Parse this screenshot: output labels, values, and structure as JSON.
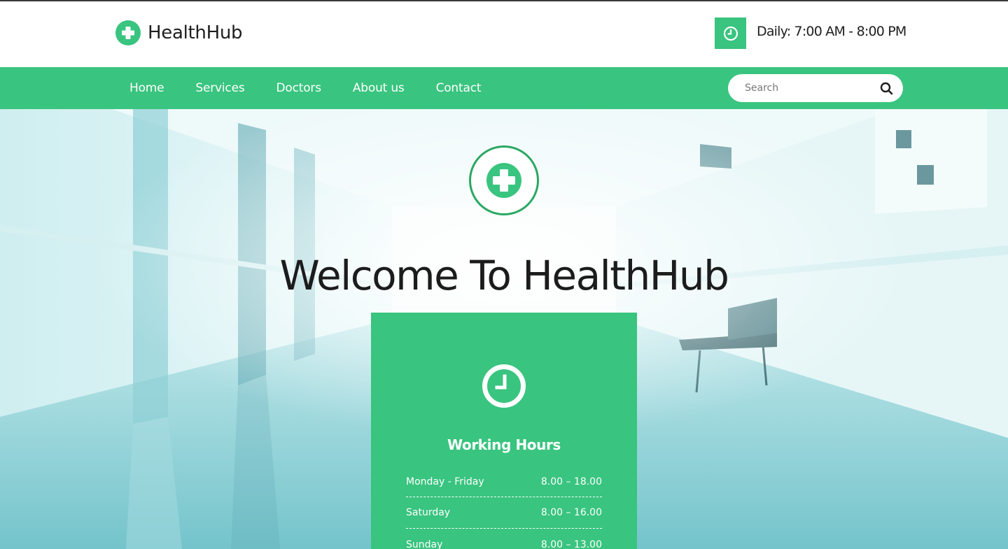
{
  "brand": {
    "name": "HealthHub",
    "icon": "medical-cross-icon"
  },
  "header": {
    "hours_text": "Daily: 7:00 AM - 8:00 PM",
    "hours_icon": "clock-icon"
  },
  "nav": {
    "items": [
      {
        "label": "Home"
      },
      {
        "label": "Services"
      },
      {
        "label": "Doctors"
      },
      {
        "label": "About us"
      },
      {
        "label": "Contact"
      }
    ]
  },
  "search": {
    "placeholder": "Search",
    "value": "",
    "icon": "search-icon"
  },
  "hero": {
    "title": "Welcome To HealthHub",
    "emblem_icon": "medical-cross-icon"
  },
  "working_hours": {
    "title": "Working Hours",
    "icon": "clock-icon",
    "rows": [
      {
        "day": "Monday - Friday",
        "hours": "8.00 – 18.00"
      },
      {
        "day": "Saturday",
        "hours": "8.00 – 16.00"
      },
      {
        "day": "Sunday",
        "hours": "8.00 – 13.00"
      }
    ]
  },
  "colors": {
    "accent": "#39c47f",
    "accent_dark": "#2aa863",
    "text_dark": "#1f1f1f"
  }
}
